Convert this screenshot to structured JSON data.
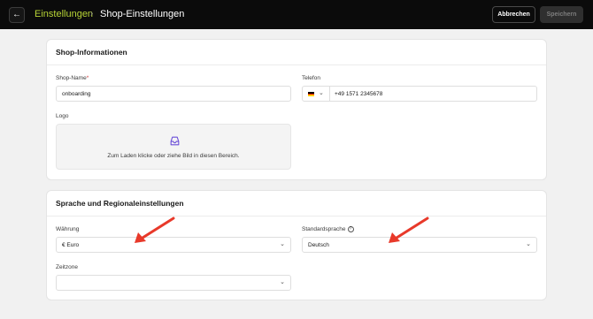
{
  "header": {
    "back_icon": "arrow-left-icon",
    "breadcrumb_parent": "Einstellungen",
    "breadcrumb_separator": "›",
    "breadcrumb_current": "Shop-Einstellungen",
    "cancel_label": "Abbrechen",
    "save_label": "Speichern"
  },
  "shop_info": {
    "title": "Shop-Informationen",
    "shop_name": {
      "label": "Shop-Name",
      "required_mark": "*",
      "value": "onboarding"
    },
    "phone": {
      "label": "Telefon",
      "country_flag": "de-flag-icon",
      "value": "+49 1571 2345678"
    },
    "logo": {
      "label": "Logo",
      "upload_icon": "inbox-tray-icon",
      "dropzone_text": "Zum Laden klicke oder ziehe Bild in diesen Bereich."
    }
  },
  "regional": {
    "title": "Sprache und Regionaleinstellungen",
    "currency": {
      "label": "Währung",
      "value": "€ Euro"
    },
    "language": {
      "label": "Standardsprache",
      "value": "Deutsch",
      "help_icon": "question-circle-icon"
    },
    "timezone": {
      "label": "Zeitzone",
      "value": ""
    }
  },
  "annotations": {
    "arrow_color": "#e8392a"
  },
  "colors": {
    "accent": "#b7d336",
    "topbar": "#0b0b0b"
  }
}
